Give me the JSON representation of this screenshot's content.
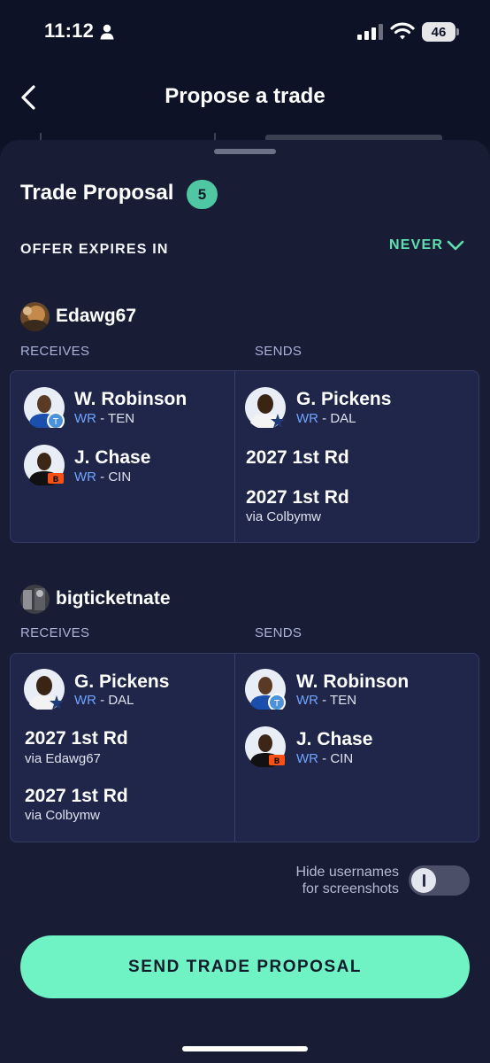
{
  "status_bar": {
    "time": "11:12",
    "battery": "46"
  },
  "nav": {
    "title": "Propose a trade"
  },
  "proposal": {
    "title": "Trade Proposal",
    "count": "5",
    "expires_label": "OFFER EXPIRES IN",
    "expires_value": "NEVER"
  },
  "parties": [
    {
      "username": "Edawg67",
      "receives_label": "RECEIVES",
      "sends_label": "SENDS",
      "receives": [
        {
          "name": "W. Robinson",
          "pos": "WR",
          "team": " - TEN"
        },
        {
          "name": "J. Chase",
          "pos": "WR",
          "team": " - CIN"
        }
      ],
      "sends_player": {
        "name": "G. Pickens",
        "pos": "WR",
        "team": " - DAL"
      },
      "sends_picks": [
        {
          "name": "2027 1st Rd",
          "via": ""
        },
        {
          "name": "2027 1st Rd",
          "via": "via Colbymw"
        }
      ]
    },
    {
      "username": "bigticketnate",
      "receives_label": "RECEIVES",
      "sends_label": "SENDS",
      "receives_player": {
        "name": "G. Pickens",
        "pos": "WR",
        "team": " - DAL"
      },
      "receives_picks": [
        {
          "name": "2027 1st Rd",
          "via": "via Edawg67"
        },
        {
          "name": "2027 1st Rd",
          "via": "via Colbymw"
        }
      ],
      "sends": [
        {
          "name": "W. Robinson",
          "pos": "WR",
          "team": " - TEN"
        },
        {
          "name": "J. Chase",
          "pos": "WR",
          "team": " - CIN"
        }
      ]
    }
  ],
  "hide_usernames": {
    "line1": "Hide usernames",
    "line2": "for screenshots",
    "enabled": false
  },
  "send_button": "SEND TRADE PROPOSAL",
  "colors": {
    "accent": "#6ff2c4",
    "badge": "#4fc7a2",
    "position": "#6fa4ff",
    "panel": "#20264a"
  }
}
